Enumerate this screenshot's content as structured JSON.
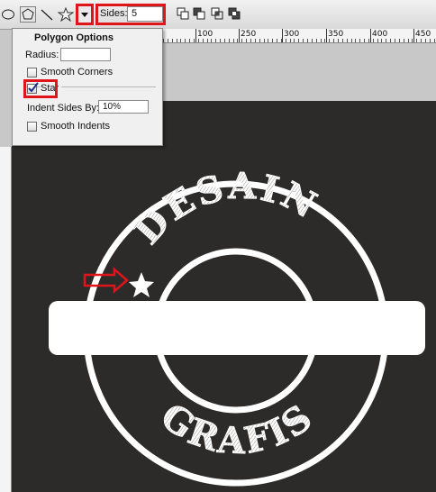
{
  "toolbar": {
    "tools": [
      {
        "name": "ellipse-tool-icon"
      },
      {
        "name": "polygon-tool-icon"
      },
      {
        "name": "line-tool-icon"
      },
      {
        "name": "custom-shape-tool-icon"
      }
    ],
    "sides_label": "Sides:",
    "sides_value": "5",
    "combine_icons": [
      "add-to-shape-icon",
      "subtract-shape-icon",
      "intersect-shape-icon",
      "exclude-shape-icon"
    ]
  },
  "ruler": {
    "marks": [
      "100",
      "250",
      "300",
      "350",
      "400",
      "450"
    ]
  },
  "polygon_options": {
    "title": "Polygon Options",
    "radius_label": "Radius:",
    "radius_value": "",
    "smooth_corners_label": "Smooth Corners",
    "smooth_corners_checked": false,
    "star_label": "Star",
    "star_checked": true,
    "indent_label": "Indent Sides By:",
    "indent_value": "10%",
    "smooth_indents_label": "Smooth Indents",
    "smooth_indents_checked": false
  },
  "artwork": {
    "top_text": "DESAIN",
    "bottom_text": "GRAFIS",
    "background": "#2d2b29",
    "foreground": "#ffffff"
  },
  "annotation_color": "#e0151b"
}
